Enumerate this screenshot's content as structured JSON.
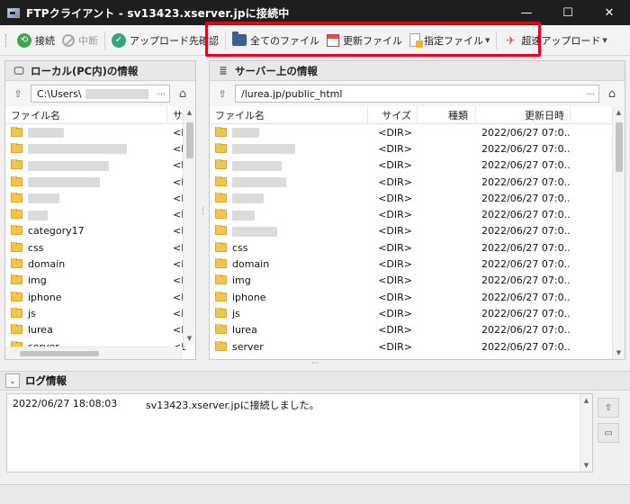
{
  "window": {
    "title": "FTPクライアント - sv13423.xserver.jpに接続中",
    "minimize": "—",
    "maximize": "☐",
    "close": "✕"
  },
  "toolbar": {
    "connect": "接続",
    "disconnect": "中断",
    "upload_dest": "アップロード先確認",
    "all_files": "全てのファイル",
    "updated_files": "更新ファイル",
    "specified_files": "指定ファイル",
    "fast_upload": "超速アップロード",
    "highlight_color": "#e6001f"
  },
  "local": {
    "header": "ローカル(PC内)の情報",
    "path": "C:\\Users\\",
    "path_dots": "...",
    "col_name": "ファイル名",
    "col_size": "サ",
    "rows": [
      {
        "name": "",
        "size": "<D",
        "blur": 40
      },
      {
        "name": "",
        "size": "<D",
        "blur": 110
      },
      {
        "name": "",
        "size": "<D",
        "blur": 90
      },
      {
        "name": "",
        "size": "<D",
        "blur": 80
      },
      {
        "name": "",
        "size": "<D",
        "blur": 35
      },
      {
        "name": "",
        "size": "<D",
        "blur": 22
      },
      {
        "name": "category17",
        "size": "<D"
      },
      {
        "name": "css",
        "size": "<D"
      },
      {
        "name": "domain",
        "size": "<D"
      },
      {
        "name": "img",
        "size": "<D"
      },
      {
        "name": "iphone",
        "size": "<D"
      },
      {
        "name": "js",
        "size": "<D"
      },
      {
        "name": "lurea",
        "size": "<D"
      },
      {
        "name": "server",
        "size": "<D"
      }
    ]
  },
  "server": {
    "header": "サーバー上の情報",
    "path": "/lurea.jp/public_html",
    "path_dots": "...",
    "col_name": "ファイル名",
    "col_size": "サイズ",
    "col_type": "種類",
    "col_date": "更新日時",
    "rows": [
      {
        "name": "",
        "size": "<DIR>",
        "date": "2022/06/27 07:0...",
        "blur": 30
      },
      {
        "name": "",
        "size": "<DIR>",
        "date": "2022/06/27 07:0...",
        "blur": 70
      },
      {
        "name": "",
        "size": "<DIR>",
        "date": "2022/06/27 07:0...",
        "blur": 55
      },
      {
        "name": "",
        "size": "<DIR>",
        "date": "2022/06/27 07:0...",
        "blur": 60
      },
      {
        "name": "",
        "size": "<DIR>",
        "date": "2022/06/27 07:0...",
        "blur": 35
      },
      {
        "name": "",
        "size": "<DIR>",
        "date": "2022/06/27 07:0...",
        "blur": 25
      },
      {
        "name": "",
        "size": "<DIR>",
        "date": "2022/06/27 07:0...",
        "blur": 50
      },
      {
        "name": "css",
        "size": "<DIR>",
        "date": "2022/06/27 07:0..."
      },
      {
        "name": "domain",
        "size": "<DIR>",
        "date": "2022/06/27 07:0..."
      },
      {
        "name": "img",
        "size": "<DIR>",
        "date": "2022/06/27 07:0..."
      },
      {
        "name": "iphone",
        "size": "<DIR>",
        "date": "2022/06/27 07:0..."
      },
      {
        "name": "js",
        "size": "<DIR>",
        "date": "2022/06/27 07:0..."
      },
      {
        "name": "lurea",
        "size": "<DIR>",
        "date": "2022/06/27 07:0..."
      },
      {
        "name": "server",
        "size": "<DIR>",
        "date": "2022/06/27 07:0..."
      }
    ]
  },
  "log": {
    "header": "ログ情報",
    "entries": [
      {
        "time": "2022/06/27 18:08:03",
        "message": "sv13423.xserver.jpに接続しました。"
      }
    ]
  }
}
